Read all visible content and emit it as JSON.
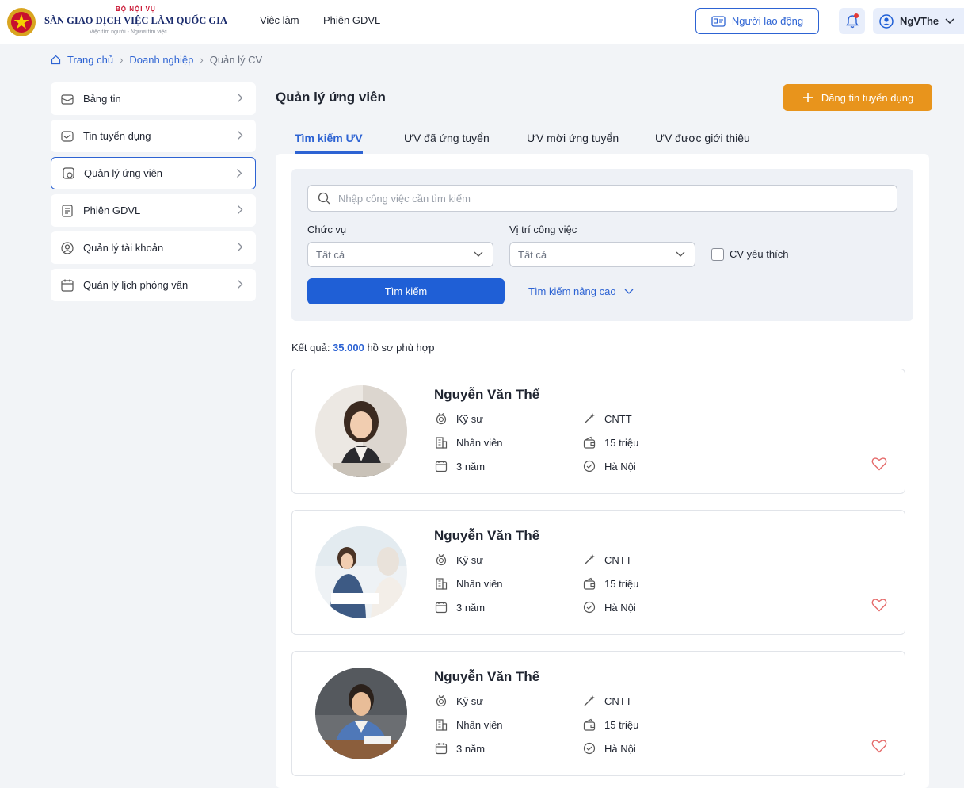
{
  "header": {
    "logo_top": "BỘ NỘI VỤ",
    "logo_main": "SÀN GIAO DỊCH VIỆC LÀM QUỐC GIA",
    "logo_sub": "Việc tìm người - Người tìm việc",
    "nav": [
      "Việc làm",
      "Phiên GDVL"
    ],
    "worker_button": "Người lao động",
    "username": "NgVThe"
  },
  "breadcrumb": {
    "home": "Trang chủ",
    "company": "Doanh nghiệp",
    "current": "Quản lý CV"
  },
  "sidebar": {
    "items": [
      {
        "label": "Bảng tin",
        "icon": "news-icon"
      },
      {
        "label": "Tin tuyển dụng",
        "icon": "job-post-icon"
      },
      {
        "label": "Quản lý ứng viên",
        "icon": "candidate-icon",
        "active": true
      },
      {
        "label": "Phiên GDVL",
        "icon": "session-icon"
      },
      {
        "label": "Quản lý tài khoản",
        "icon": "account-icon"
      },
      {
        "label": "Quản lý lịch phỏng vấn",
        "icon": "calendar-icon"
      }
    ]
  },
  "main": {
    "title": "Quản lý ứng viên",
    "post_button": "Đăng tin tuyển dụng",
    "tabs": [
      "Tìm kiếm ƯV",
      "ƯV đã ứng tuyển",
      "ƯV mời ứng tuyển",
      "ƯV được giới thiệu"
    ],
    "search_placeholder": "Nhập công việc cần tìm kiếm",
    "filter_position_label": "Chức vụ",
    "filter_position_value": "Tất cả",
    "filter_location_label": "Vị trí công việc",
    "filter_location_value": "Tất cả",
    "favorite_label": "CV yêu thích",
    "search_button": "Tìm kiếm",
    "advanced_link": "Tìm kiếm nâng cao",
    "results_prefix": "Kết quả:",
    "results_count": "35.000",
    "results_suffix": "hồ sơ phù hợp"
  },
  "candidates": [
    {
      "name": "Nguyễn Văn Thế",
      "title": "Kỹ sư",
      "role": "Nhân viên",
      "experience": "3 năm",
      "field": "CNTT",
      "salary": "15 triệu",
      "location": "Hà Nội",
      "avatar": "woman-office"
    },
    {
      "name": "Nguyễn Văn Thế",
      "title": "Kỹ sư",
      "role": "Nhân viên",
      "experience": "3 năm",
      "field": "CNTT",
      "salary": "15 triệu",
      "location": "Hà Nội",
      "avatar": "interview"
    },
    {
      "name": "Nguyễn Văn Thế",
      "title": "Kỹ sư",
      "role": "Nhân viên",
      "experience": "3 năm",
      "field": "CNTT",
      "salary": "15 triệu",
      "location": "Hà Nội",
      "avatar": "man-desk"
    }
  ],
  "colors": {
    "primary": "#2d63d3",
    "accent": "#e8941c",
    "brand_red": "#c8102e"
  }
}
